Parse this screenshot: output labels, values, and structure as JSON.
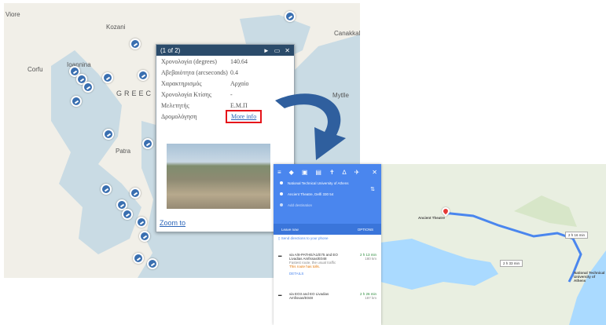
{
  "map1": {
    "labels": {
      "viore": "Viore",
      "kozani": "Kozani",
      "corfu": "Corfu",
      "ioannina": "Ioannina",
      "canakkale": "Canakkal",
      "greece": "GREEC",
      "mytilene": "Mytlle",
      "patra": "Patra"
    }
  },
  "popup": {
    "header": "(1 of 2)",
    "controls": {
      "next": "►",
      "max": "▭",
      "close": "✕"
    },
    "rows": [
      {
        "key": "Χρονολογία (degrees)",
        "value": "140.64"
      },
      {
        "key": "Αβεβαιότητα (arcseconds)",
        "value": "0.4"
      },
      {
        "key": "Χαρακτηρισμός",
        "value": "Αρχαίο"
      },
      {
        "key": "Χρονολογία Κτίσης",
        "value": "-"
      },
      {
        "key": "Μελετητής",
        "value": "Ε.Μ.Π"
      },
      {
        "key": "Δρομολόγηση",
        "value": "More info"
      }
    ],
    "zoom_link": "Zoom to"
  },
  "directions": {
    "origin": "National Technical University of Athens",
    "destination": "Ancient Theatre, Delfi 330 54",
    "add_destination": "Add destination",
    "leave_now": "Leave now",
    "options": "OPTIONS",
    "send_to_phone": "Send directions to your phone",
    "routes": [
      {
        "via": "via A/8-PATHE/A1/E75 and EO Livadias Amfissas/E048",
        "time": "2 h 13 min",
        "dist": "180 km",
        "sub": "Fastest route, the usual traffic",
        "warn": "This route has tolls.",
        "details": "DETAILS"
      },
      {
        "via": "via EO3 and EO Livadias Amfissas/E048",
        "time": "2 h 26 min",
        "dist": "187 km"
      }
    ]
  },
  "map2": {
    "start_label": "Ancient Theatre",
    "end_label": "National Technical University of Athens",
    "bubble1": "2 h 16 min",
    "bubble2": "2 h 33 min",
    "route_color": "#4a86ee"
  },
  "colors": {
    "popup_header": "#2b4b6a",
    "highlight": "#e5141a",
    "arrow": "#2f5f9e"
  }
}
